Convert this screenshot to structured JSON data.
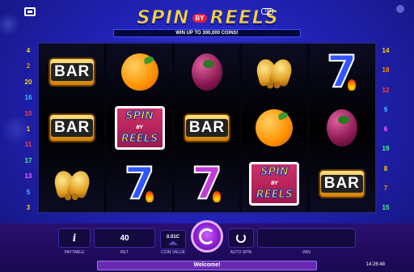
{
  "game": {
    "logo_word1": "SPIN",
    "logo_by": "BY",
    "logo_word2": "REELS",
    "logo_tm": "TM",
    "banner": "WIN UP TO 300,000 COINS!"
  },
  "paylines": {
    "left": [
      {
        "n": "4",
        "color": "#ffd400"
      },
      {
        "n": "2",
        "color": "#ff8a00"
      },
      {
        "n": "20",
        "color": "#ffd400"
      },
      {
        "n": "16",
        "color": "#40c0ff"
      },
      {
        "n": "10",
        "color": "#ff4040"
      },
      {
        "n": "1",
        "color": "#ffd400"
      },
      {
        "n": "11",
        "color": "#ff4040"
      },
      {
        "n": "17",
        "color": "#40ff80"
      },
      {
        "n": "13",
        "color": "#ff60ff"
      },
      {
        "n": "5",
        "color": "#40c0ff"
      },
      {
        "n": "3",
        "color": "#ffd400"
      }
    ],
    "right": [
      {
        "n": "14",
        "color": "#ffd400"
      },
      {
        "n": "18",
        "color": "#ff8a00"
      },
      {
        "n": "12",
        "color": "#ff4040"
      },
      {
        "n": "9",
        "color": "#40c0ff"
      },
      {
        "n": "6",
        "color": "#ff60ff"
      },
      {
        "n": "19",
        "color": "#40ff80"
      },
      {
        "n": "8",
        "color": "#ffd400"
      },
      {
        "n": "7",
        "color": "#ff8a00"
      },
      {
        "n": "15",
        "color": "#40ff80"
      }
    ]
  },
  "reels": [
    [
      {
        "type": "bar",
        "label": "BAR"
      },
      {
        "type": "bar",
        "label": "BAR"
      },
      {
        "type": "bells",
        "icon": "bells-icon"
      }
    ],
    [
      {
        "type": "orange",
        "icon": "orange-icon"
      },
      {
        "type": "spin",
        "line1": "SPIN",
        "line2": "REELS",
        "by": "BY"
      },
      {
        "type": "seven",
        "label": "7",
        "color": "#2f56ff"
      }
    ],
    [
      {
        "type": "plum",
        "icon": "plum-icon"
      },
      {
        "type": "bar",
        "label": "BAR"
      },
      {
        "type": "seven",
        "label": "7",
        "color": "#c23bd8"
      }
    ],
    [
      {
        "type": "bells",
        "icon": "bells-icon"
      },
      {
        "type": "orange",
        "icon": "orange-icon"
      },
      {
        "type": "spin",
        "line1": "SPIN",
        "line2": "REELS",
        "by": "BY"
      }
    ],
    [
      {
        "type": "seven",
        "label": "7",
        "color": "#2f56ff"
      },
      {
        "type": "plum",
        "icon": "plum-icon"
      },
      {
        "type": "bar",
        "label": "BAR"
      }
    ]
  ],
  "controls": {
    "paytable_label": "PAYTABLE",
    "paytable_icon": "i",
    "bet_label": "BET",
    "bet_value": "40",
    "coin_value_label": "COIN VALUE",
    "coin_value": "0.01C",
    "auto_spin_label": "AUTO SPIN",
    "win_label": "WIN",
    "win_value": ""
  },
  "status": {
    "message": "Welcome!",
    "time": "14:26:48"
  }
}
